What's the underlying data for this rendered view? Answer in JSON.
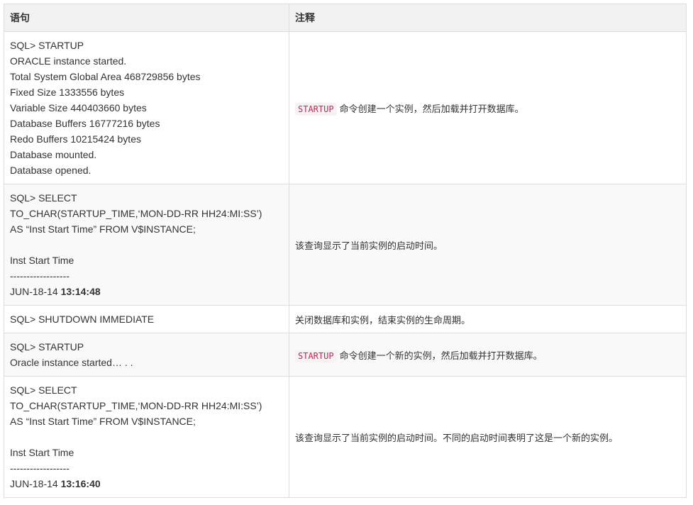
{
  "table": {
    "headers": [
      "语句",
      "注释"
    ],
    "rows": [
      {
        "statement": [
          "SQL> STARTUP",
          "ORACLE instance started.",
          "Total System Global Area 468729856 bytes",
          "Fixed Size 1333556 bytes",
          "Variable Size 440403660 bytes",
          "Database Buffers 16777216 bytes",
          "Redo Buffers 10215424 bytes",
          "Database mounted.",
          "Database opened."
        ],
        "note_code": "STARTUP",
        "note_text": "命令创建一个实例，然后加载并打开数据库。"
      },
      {
        "statement": [
          "SQL> SELECT",
          "TO_CHAR(STARTUP_TIME,‘MON-DD-RR HH24:MI:SS’)",
          "AS “Inst Start Time” FROM V$INSTANCE;",
          "",
          "Inst Start Time",
          "------------------"
        ],
        "result_date": "JUN-18-14 ",
        "result_time": "13:14:48",
        "note_text": "该查询显示了当前实例的启动时间。"
      },
      {
        "statement": [
          "SQL> SHUTDOWN IMMEDIATE"
        ],
        "note_text": "关闭数据库和实例，结束实例的生命周期。"
      },
      {
        "statement": [
          "SQL> STARTUP",
          "Oracle instance started… . ."
        ],
        "note_code": "STARTUP",
        "note_text": "命令创建一个新的实例，然后加载并打开数据库。"
      },
      {
        "statement": [
          "SQL> SELECT",
          "TO_CHAR(STARTUP_TIME,‘MON-DD-RR HH24:MI:SS’)",
          "AS “Inst Start Time” FROM V$INSTANCE;",
          "",
          "Inst Start Time",
          "------------------"
        ],
        "result_date": "JUN-18-14 ",
        "result_time": "13:16:40",
        "note_text": "该查询显示了当前实例的启动时间。不同的启动时间表明了这是一个新的实例。"
      }
    ]
  }
}
